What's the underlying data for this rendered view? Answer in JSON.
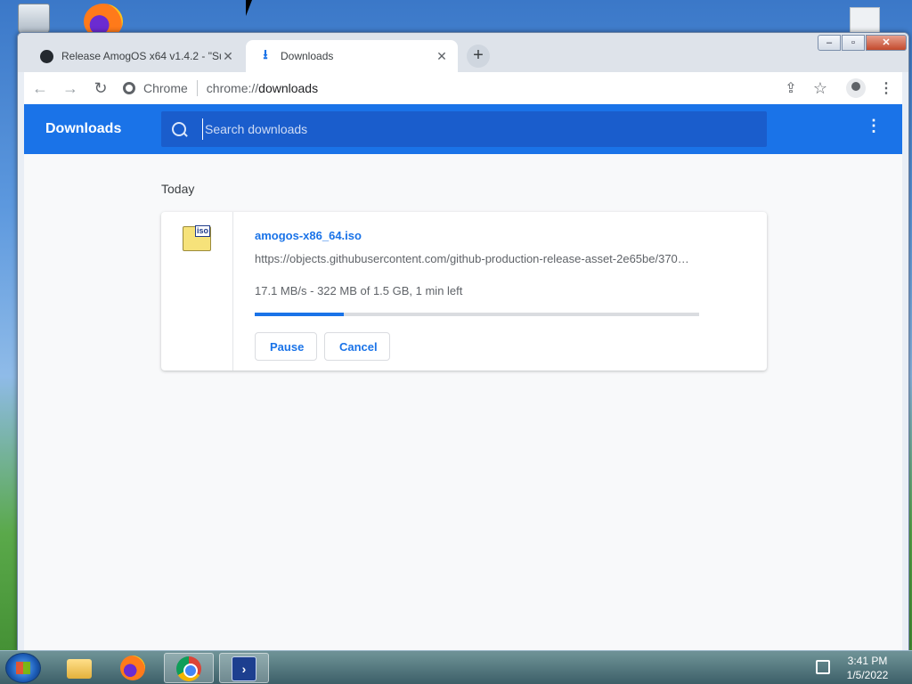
{
  "browser": {
    "tabs": [
      {
        "title": "Release AmogOS x64 v1.4.2 - \"Su",
        "icon": "github-icon",
        "active": false
      },
      {
        "title": "Downloads",
        "icon": "download-icon",
        "active": true
      }
    ],
    "new_tab_label": "+",
    "omnibox": {
      "brand": "Chrome",
      "url_scheme": "chrome://",
      "url_host": "downloads"
    },
    "window_controls": {
      "minimize": "–",
      "maximize": "▫",
      "close": "✕"
    }
  },
  "downloads": {
    "header_title": "Downloads",
    "search_placeholder": "Search downloads",
    "date_group": "Today",
    "item": {
      "filename": "amogos-x86_64.iso",
      "url": "https://objects.githubusercontent.com/github-production-release-asset-2e65be/370…",
      "status": "17.1 MB/s - 322 MB of 1.5 GB, 1 min left",
      "progress_fraction": 0.2,
      "file_badge": "iso",
      "pause_label": "Pause",
      "cancel_label": "Cancel"
    }
  },
  "taskbar": {
    "time": "3:41 PM",
    "date": "1/5/2022",
    "apps": [
      "explorer-icon",
      "firefox-icon",
      "chrome-icon",
      "powershell-icon"
    ]
  },
  "colors": {
    "accent": "#1a73e8",
    "header": "#1a73e8"
  }
}
